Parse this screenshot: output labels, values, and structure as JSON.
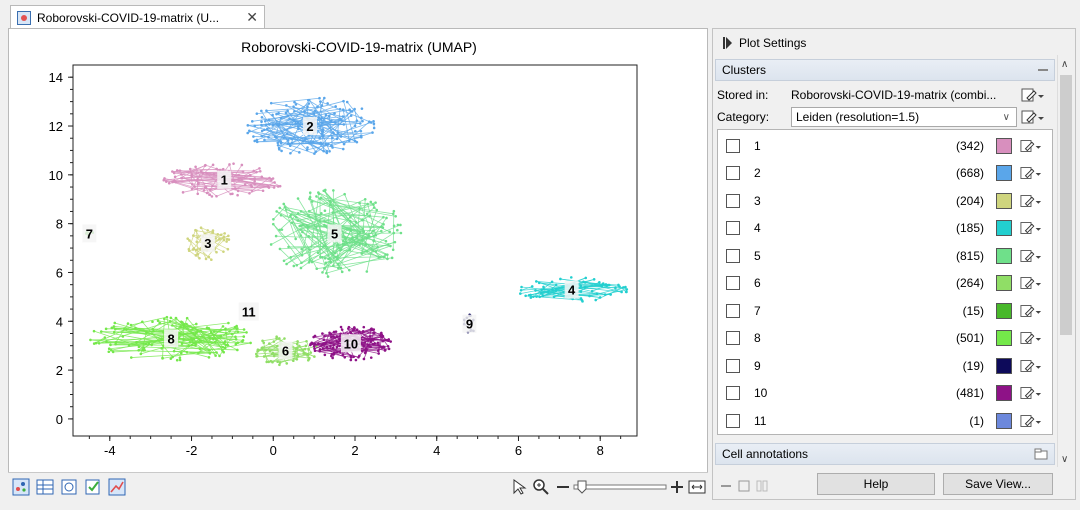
{
  "tab": {
    "title": "Roborovski-COVID-19-matrix (U...",
    "close_glyph": "✕"
  },
  "plot": {
    "title": "Roborovski-COVID-19-matrix (UMAP)",
    "x_ticks": [
      "-4",
      "-2",
      "0",
      "2",
      "4",
      "6",
      "8"
    ],
    "y_ticks": [
      "0",
      "2",
      "4",
      "6",
      "8",
      "10",
      "12",
      "14"
    ]
  },
  "chart_data": {
    "type": "scatter",
    "title": "Roborovski-COVID-19-matrix (UMAP)",
    "xlim": [
      -4.9,
      8.9
    ],
    "ylim": [
      -0.7,
      14.5
    ],
    "grid": false,
    "clusters": [
      {
        "label": "1",
        "x": -1.2,
        "y": 9.8,
        "color": "#d88fbe"
      },
      {
        "label": "2",
        "x": 0.9,
        "y": 12.0,
        "color": "#5aa6ea"
      },
      {
        "label": "3",
        "x": -1.6,
        "y": 7.2,
        "color": "#cfd57e"
      },
      {
        "label": "4",
        "x": 7.3,
        "y": 5.3,
        "color": "#22cfcf"
      },
      {
        "label": "5",
        "x": 1.5,
        "y": 7.6,
        "color": "#6fe08a"
      },
      {
        "label": "6",
        "x": 0.3,
        "y": 2.8,
        "color": "#90de66"
      },
      {
        "label": "7",
        "x": -4.5,
        "y": 7.6,
        "color": "#48b82a"
      },
      {
        "label": "8",
        "x": -2.5,
        "y": 3.3,
        "color": "#74e84a"
      },
      {
        "label": "9",
        "x": 4.8,
        "y": 3.9,
        "color": "#0d0a5a"
      },
      {
        "label": "10",
        "x": 1.9,
        "y": 3.1,
        "color": "#8e1287"
      },
      {
        "label": "11",
        "x": -0.6,
        "y": 4.4,
        "color": "#6c88dc"
      }
    ]
  },
  "panel": {
    "header": "Plot Settings",
    "clusters_section": "Clusters",
    "stored_in_label": "Stored in:",
    "stored_in_value": "Roborovski-COVID-19-matrix (combi...",
    "category_label": "Category:",
    "category_value": "Leiden (resolution=1.5)",
    "clusters": [
      {
        "name": "1",
        "count": "(342)",
        "color": "#d88fbe"
      },
      {
        "name": "2",
        "count": "(668)",
        "color": "#5aa6ea"
      },
      {
        "name": "3",
        "count": "(204)",
        "color": "#cfd57e"
      },
      {
        "name": "4",
        "count": "(185)",
        "color": "#22cfcf"
      },
      {
        "name": "5",
        "count": "(815)",
        "color": "#6fe08a"
      },
      {
        "name": "6",
        "count": "(264)",
        "color": "#90de66"
      },
      {
        "name": "7",
        "count": "(15)",
        "color": "#48b82a"
      },
      {
        "name": "8",
        "count": "(501)",
        "color": "#74e84a"
      },
      {
        "name": "9",
        "count": "(19)",
        "color": "#0d0a5a"
      },
      {
        "name": "10",
        "count": "(481)",
        "color": "#8e1287"
      },
      {
        "name": "11",
        "count": "(1)",
        "color": "#6c88dc"
      }
    ],
    "cell_annotations": "Cell annotations",
    "help_button": "Help",
    "save_view_button": "Save View..."
  },
  "icons": {
    "tab": "scatter-plot-icon",
    "bottom_left": [
      "scatter-view-icon",
      "table-view-icon",
      "history-icon",
      "checklist-icon",
      "chart-edit-icon"
    ],
    "zoom_tools": [
      "pointer-icon",
      "zoom-icon",
      "zoom-out-icon",
      "zoom-slider",
      "zoom-in-icon",
      "fit-width-icon"
    ]
  }
}
